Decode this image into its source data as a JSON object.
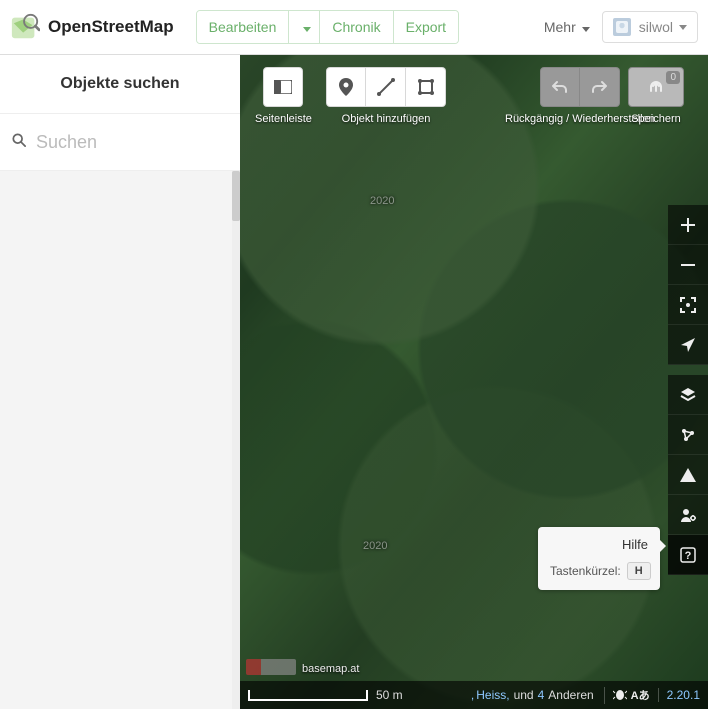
{
  "header": {
    "site_title": "OpenStreetMap",
    "tabs": {
      "edit": "Bearbeiten",
      "history": "Chronik",
      "export": "Export"
    },
    "more": "Mehr",
    "user": "silwol"
  },
  "sidebar": {
    "title": "Objekte suchen",
    "search_placeholder": "Suchen"
  },
  "editor": {
    "sidebar_label": "Seitenleiste",
    "add_label": "Objekt hinzufügen",
    "undo_redo_label": "Rückgängig / Wiederherstellen",
    "save_label": "Speichern",
    "save_count": "0"
  },
  "map_labels": {
    "a": "2020",
    "b": "2020"
  },
  "tooltip": {
    "title": "Hilfe",
    "shortcut_label": "Tastenkürzel:",
    "shortcut_key": "H"
  },
  "attribution": {
    "text": "basemap.at"
  },
  "bottom": {
    "scale_label": "50 m",
    "contrib1": "Heiss,",
    "und": "und",
    "count": "4",
    "others": "Anderen",
    "version": "2.20.1"
  }
}
